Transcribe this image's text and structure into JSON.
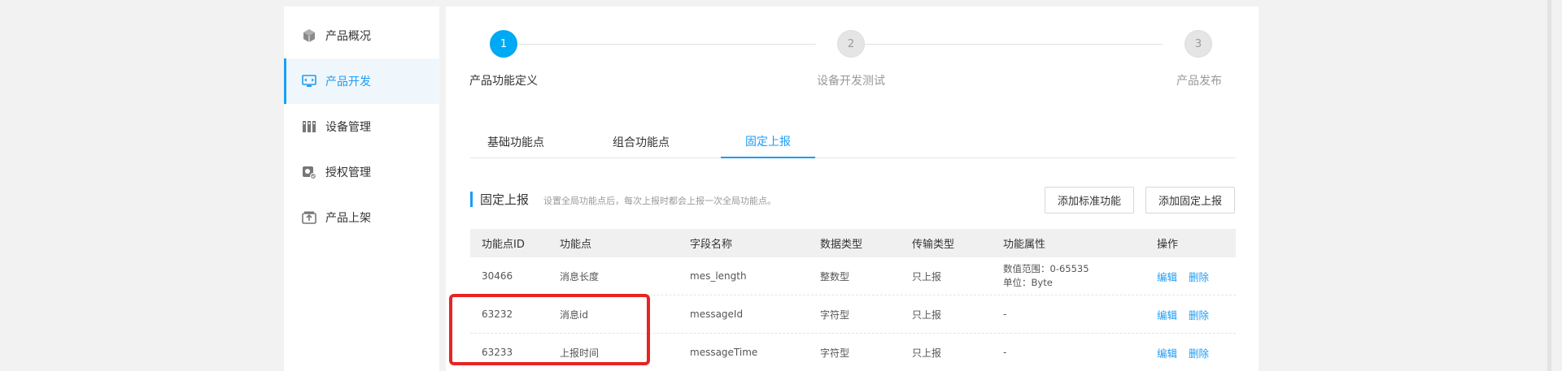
{
  "sidebar": {
    "items": [
      {
        "label": "产品概况",
        "icon": "cube-icon",
        "active": false
      },
      {
        "label": "产品开发",
        "icon": "monitor-code-icon",
        "active": true
      },
      {
        "label": "设备管理",
        "icon": "device-rack-icon",
        "active": false
      },
      {
        "label": "授权管理",
        "icon": "license-icon",
        "active": false
      },
      {
        "label": "产品上架",
        "icon": "shelf-upload-icon",
        "active": false
      }
    ]
  },
  "steps": [
    {
      "number": "1",
      "label": "产品功能定义",
      "active": true
    },
    {
      "number": "2",
      "label": "设备开发测试",
      "active": false
    },
    {
      "number": "3",
      "label": "产品发布",
      "active": false
    }
  ],
  "tabs": [
    {
      "label": "基础功能点",
      "active": false
    },
    {
      "label": "组合功能点",
      "active": false
    },
    {
      "label": "固定上报",
      "active": true
    }
  ],
  "section": {
    "title": "固定上报",
    "description": "设置全局功能点后，每次上报时都会上报一次全局功能点。",
    "add_standard_label": "添加标准功能",
    "add_fixed_label": "添加固定上报"
  },
  "table": {
    "headers": [
      "功能点ID",
      "功能点",
      "字段名称",
      "数据类型",
      "传输类型",
      "功能属性",
      "操作"
    ],
    "rows": [
      {
        "id": "30466",
        "name": "消息长度",
        "field": "mes_length",
        "type": "整数型",
        "transfer": "只上报",
        "attr_line1": "数值范围：0-65535",
        "attr_line2": "单位：Byte",
        "edit": "编辑",
        "delete": "删除"
      },
      {
        "id": "63232",
        "name": "消息id",
        "field": "messageId",
        "type": "字符型",
        "transfer": "只上报",
        "attr_line1": "-",
        "attr_line2": "",
        "edit": "编辑",
        "delete": "删除"
      },
      {
        "id": "63233",
        "name": "上报时间",
        "field": "messageTime",
        "type": "字符型",
        "transfer": "只上报",
        "attr_line1": "-",
        "attr_line2": "",
        "edit": "编辑",
        "delete": "删除"
      }
    ]
  },
  "colors": {
    "accent": "#1c9cf5",
    "step_active": "#00a9f4",
    "highlight": "#e82323"
  }
}
